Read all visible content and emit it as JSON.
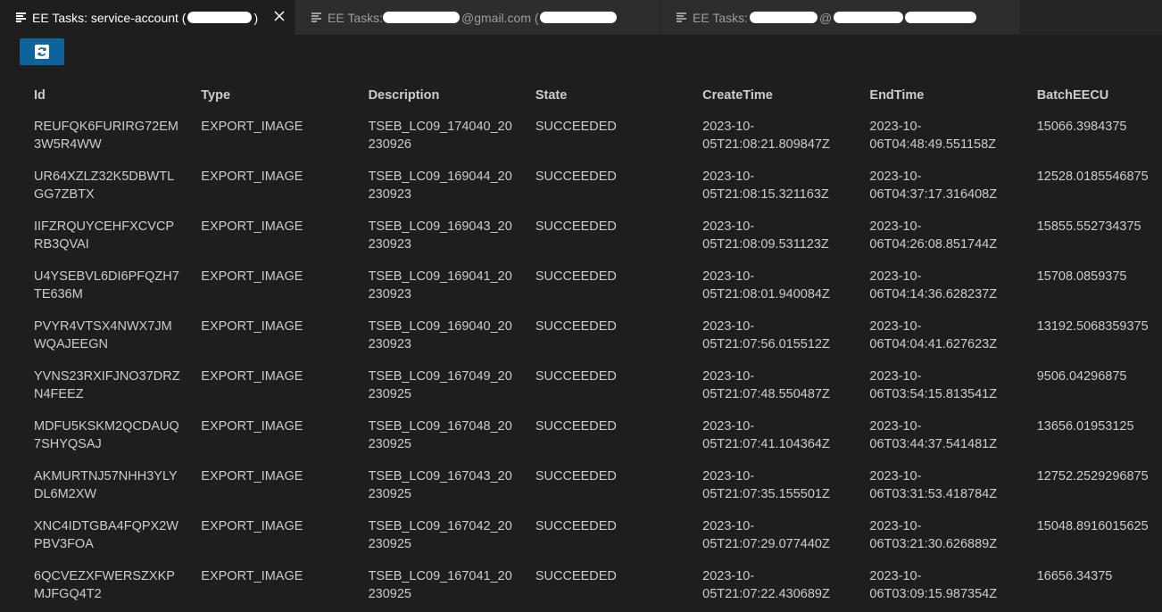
{
  "tabs": [
    {
      "prefix": "EE Tasks: service-account (",
      "suffix": ")",
      "active": true
    },
    {
      "prefix": "EE Tasks: ",
      "suffix": "@gmail.com (",
      "active": false
    },
    {
      "prefix": "EE Tasks: ",
      "suffix": "@",
      "active": false
    }
  ],
  "toolbar": {
    "refresh_icon": "refresh-icon"
  },
  "columns": [
    "Id",
    "Type",
    "Description",
    "State",
    "CreateTime",
    "EndTime",
    "BatchEECU"
  ],
  "rows": [
    {
      "id": "REUFQK6FURIRG72EM3W5R4WW",
      "type": "EXPORT_IMAGE",
      "description": "TSEB_LC09_174040_20230926",
      "state": "SUCCEEDED",
      "create_a": "2023-10-",
      "create_b": "05T21:08:21.809847Z",
      "end_a": "2023-10-",
      "end_b": "06T04:48:49.551158Z",
      "eecu": "15066.3984375"
    },
    {
      "id": "UR64XZLZ32K5DBWTLGG7ZBTX",
      "type": "EXPORT_IMAGE",
      "description": "TSEB_LC09_169044_20230923",
      "state": "SUCCEEDED",
      "create_a": "2023-10-",
      "create_b": "05T21:08:15.321163Z",
      "end_a": "2023-10-",
      "end_b": "06T04:37:17.316408Z",
      "eecu": "12528.0185546875"
    },
    {
      "id": "IIFZRQUYCEHFXCVCPRB3QVAI",
      "type": "EXPORT_IMAGE",
      "description": "TSEB_LC09_169043_20230923",
      "state": "SUCCEEDED",
      "create_a": "2023-10-",
      "create_b": "05T21:08:09.531123Z",
      "end_a": "2023-10-",
      "end_b": "06T04:26:08.851744Z",
      "eecu": "15855.552734375"
    },
    {
      "id": "U4YSEBVL6DI6PFQZH7TE636M",
      "type": "EXPORT_IMAGE",
      "description": "TSEB_LC09_169041_20230923",
      "state": "SUCCEEDED",
      "create_a": "2023-10-",
      "create_b": "05T21:08:01.940084Z",
      "end_a": "2023-10-",
      "end_b": "06T04:14:36.628237Z",
      "eecu": "15708.0859375"
    },
    {
      "id": "PVYR4VTSX4NWX7JMWQAJEEGN",
      "type": "EXPORT_IMAGE",
      "description": "TSEB_LC09_169040_20230923",
      "state": "SUCCEEDED",
      "create_a": "2023-10-",
      "create_b": "05T21:07:56.015512Z",
      "end_a": "2023-10-",
      "end_b": "06T04:04:41.627623Z",
      "eecu": "13192.5068359375"
    },
    {
      "id": "YVNS23RXIFJNO37DRZN4FEEZ",
      "type": "EXPORT_IMAGE",
      "description": "TSEB_LC09_167049_20230925",
      "state": "SUCCEEDED",
      "create_a": "2023-10-",
      "create_b": "05T21:07:48.550487Z",
      "end_a": "2023-10-",
      "end_b": "06T03:54:15.813541Z",
      "eecu": "9506.04296875"
    },
    {
      "id": "MDFU5KSKM2QCDAUQ7SHYQSAJ",
      "type": "EXPORT_IMAGE",
      "description": "TSEB_LC09_167048_20230925",
      "state": "SUCCEEDED",
      "create_a": "2023-10-",
      "create_b": "05T21:07:41.104364Z",
      "end_a": "2023-10-",
      "end_b": "06T03:44:37.541481Z",
      "eecu": "13656.01953125"
    },
    {
      "id": "AKMURTNJ57NHH3YLYDL6M2XW",
      "type": "EXPORT_IMAGE",
      "description": "TSEB_LC09_167043_20230925",
      "state": "SUCCEEDED",
      "create_a": "2023-10-",
      "create_b": "05T21:07:35.155501Z",
      "end_a": "2023-10-",
      "end_b": "06T03:31:53.418784Z",
      "eecu": "12752.2529296875"
    },
    {
      "id": "XNC4IDTGBA4FQPX2WPBV3FOA",
      "type": "EXPORT_IMAGE",
      "description": "TSEB_LC09_167042_20230925",
      "state": "SUCCEEDED",
      "create_a": "2023-10-",
      "create_b": "05T21:07:29.077440Z",
      "end_a": "2023-10-",
      "end_b": "06T03:21:30.626889Z",
      "eecu": "15048.8916015625"
    },
    {
      "id": "6QCVEZXFWERSZXKPMJFGQ4T2",
      "type": "EXPORT_IMAGE",
      "description": "TSEB_LC09_167041_20230925",
      "state": "SUCCEEDED",
      "create_a": "2023-10-",
      "create_b": "05T21:07:22.430689Z",
      "end_a": "2023-10-",
      "end_b": "06T03:09:15.987354Z",
      "eecu": "16656.34375"
    }
  ]
}
